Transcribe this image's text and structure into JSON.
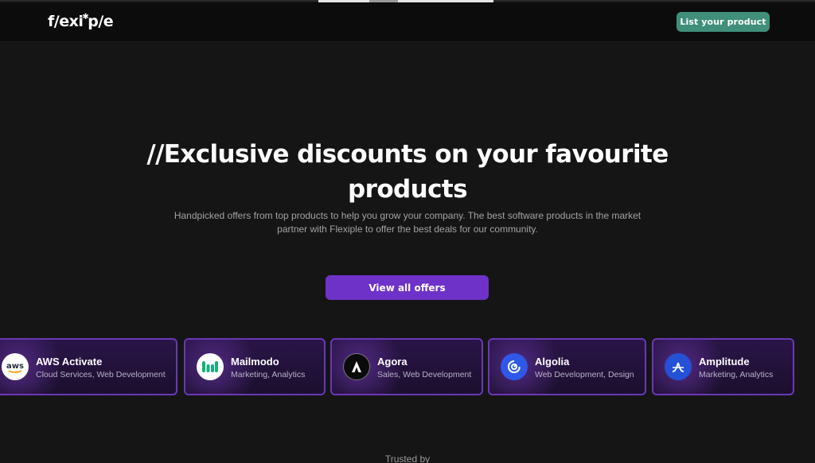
{
  "header": {
    "logo_text": "flexiple",
    "cta_label": "List your product",
    "accent": "#3f8f7a"
  },
  "hero": {
    "title_line1": "//Exclusive discounts on your favourite",
    "title_line2": "products",
    "subtitle": "Handpicked offers from top products to help you grow your company. The best software products in the market partner with Flexiple to offer the best deals for our community.",
    "cta_label": "View all offers",
    "cta_color": "#6f32c9"
  },
  "offers": [
    {
      "name": "AWS Activate",
      "tags": "Cloud Services, Web Development",
      "icon": "aws-logo-icon",
      "icon_text": "aws"
    },
    {
      "name": "Mailmodo",
      "tags": "Marketing, Analytics",
      "icon": "mailmodo-logo-icon"
    },
    {
      "name": "Agora",
      "tags": "Sales, Web Development",
      "icon": "agora-logo-icon"
    },
    {
      "name": "Algolia",
      "tags": "Web Development, Design",
      "icon": "algolia-logo-icon"
    },
    {
      "name": "Amplitude",
      "tags": "Marketing, Analytics",
      "icon": "amplitude-logo-icon"
    }
  ],
  "trusted_label": "Trusted by"
}
